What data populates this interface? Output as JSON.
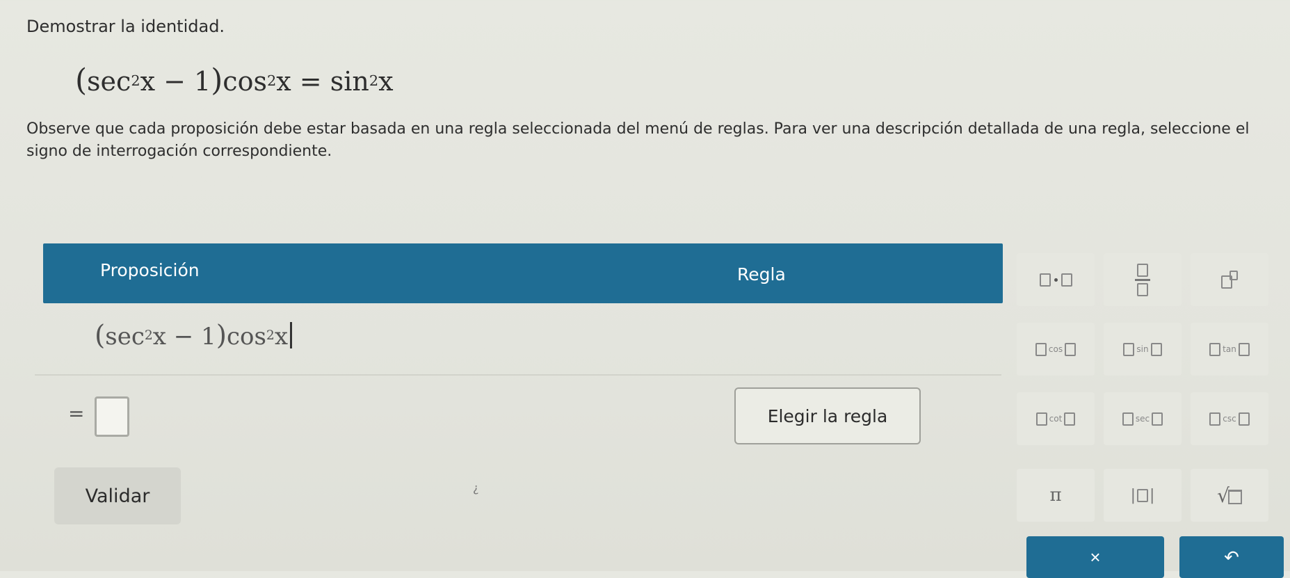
{
  "problem": {
    "heading": "Demostrar la identidad.",
    "identity": {
      "lhs_func": "sec",
      "lhs_exp": "2",
      "lhs_var": "x",
      "minus_one": " − 1",
      "mul_func": "cos",
      "mul_exp": "2",
      "mul_var": "x",
      "equals": " = ",
      "rhs_func": "sin",
      "rhs_exp": "2",
      "rhs_var": "x"
    },
    "note": "Observe que cada proposición debe estar basada en una regla seleccionada del menú de reglas. Para ver una descripción detallada de una regla, seleccione el signo de interrogación correspondiente."
  },
  "table": {
    "col_proposition": "Proposición",
    "col_rule": "Regla",
    "row1": {
      "func1": "sec",
      "exp1": "2",
      "var1": "x",
      "minus_one": " − 1",
      "func2": "cos",
      "exp2": "2",
      "var2": "x"
    },
    "row2": {
      "equals": "="
    }
  },
  "buttons": {
    "choose_rule": "Elegir la regla",
    "validate": "Validar",
    "help_mark": "¿",
    "clear": "×",
    "undo": "↶"
  },
  "keypad": {
    "cos": "cos",
    "sin": "sin",
    "tan": "tan",
    "cot": "cot",
    "sec": "sec",
    "csc": "csc",
    "pi": "π",
    "pipe_left": "|",
    "pipe_right": "|",
    "sqrt": "√"
  },
  "colors": {
    "header_bg": "#1f6d94",
    "page_bg": "#e5e6df",
    "key_bg": "#e6e7e0"
  }
}
